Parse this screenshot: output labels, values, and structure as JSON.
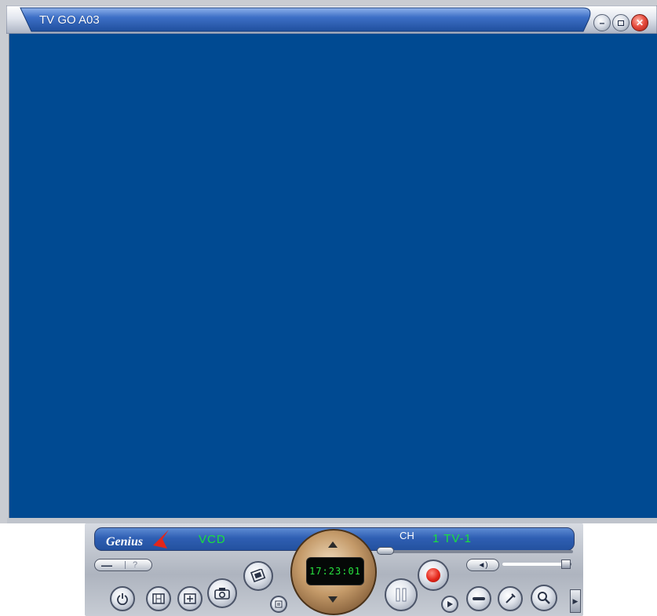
{
  "window": {
    "title": "TV GO A03",
    "controls": [
      "minimize",
      "maximize",
      "close"
    ],
    "video_color": "#004a92"
  },
  "panel": {
    "brand": "Genius",
    "mode": "VCD",
    "channel_label": "CH",
    "channel_value": "1 TV-1",
    "clock": "17:23:01",
    "mini_minus": "—",
    "mini_help": "?",
    "volume_icon": "◄)",
    "volume_level": 0.92,
    "channel_slider_level": 0.0,
    "expand_icon": "▶",
    "icons": {
      "power": "power-icon",
      "source": "film-icon",
      "fullscreen": "fullscreen-icon",
      "snapshot": "camera-icon",
      "gallery": "album-icon",
      "list": "list-icon",
      "pause": "pause-icon",
      "record": "record-icon",
      "play": "play-icon",
      "mute": "mute-icon",
      "settings": "tools-icon",
      "zoom": "magnifier-icon"
    }
  },
  "colors": {
    "display_text": "#19e23b",
    "record": "#e3261a"
  }
}
